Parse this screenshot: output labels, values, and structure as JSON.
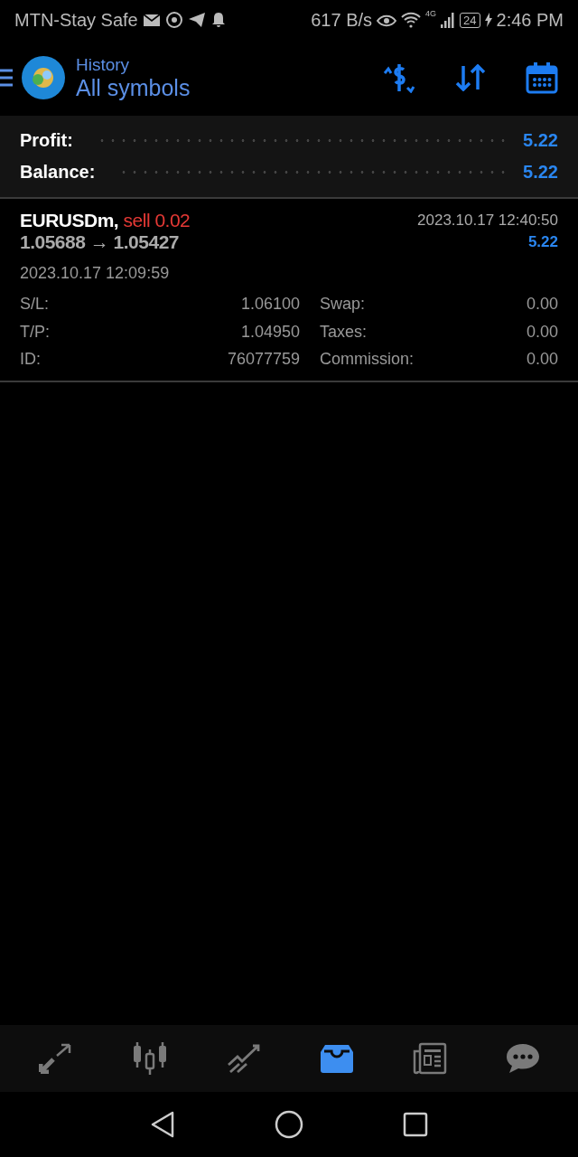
{
  "status_bar": {
    "carrier": "MTN-Stay Safe",
    "speed": "617 B/s",
    "network": "4G",
    "battery": "24",
    "time": "2:46 PM"
  },
  "header": {
    "title": "History",
    "subtitle": "All symbols"
  },
  "summary": [
    {
      "label": "Profit:",
      "value": "5.22"
    },
    {
      "label": "Balance:",
      "value": "5.22"
    }
  ],
  "deals": [
    {
      "symbol": "EURUSDm,",
      "side": "sell 0.02",
      "prices": "1.05688 → 1.05427",
      "close_time": "2023.10.17 12:40:50",
      "profit": "5.22",
      "open_time": "2023.10.17 12:09:59",
      "fields": [
        {
          "label": "S/L:",
          "value": "1.06100",
          "label2": "Swap:",
          "value2": "0.00"
        },
        {
          "label": "T/P:",
          "value": "1.04950",
          "label2": "Taxes:",
          "value2": "0.00"
        },
        {
          "label": "ID:",
          "value": "76077759",
          "label2": "Commission:",
          "value2": "0.00"
        }
      ]
    }
  ],
  "bottom_nav": [
    {
      "kind": "trade",
      "selected": false
    },
    {
      "kind": "quotes",
      "selected": false
    },
    {
      "kind": "chart",
      "selected": false
    },
    {
      "kind": "history",
      "selected": true
    },
    {
      "kind": "news",
      "selected": false
    },
    {
      "kind": "chat",
      "selected": false
    }
  ]
}
